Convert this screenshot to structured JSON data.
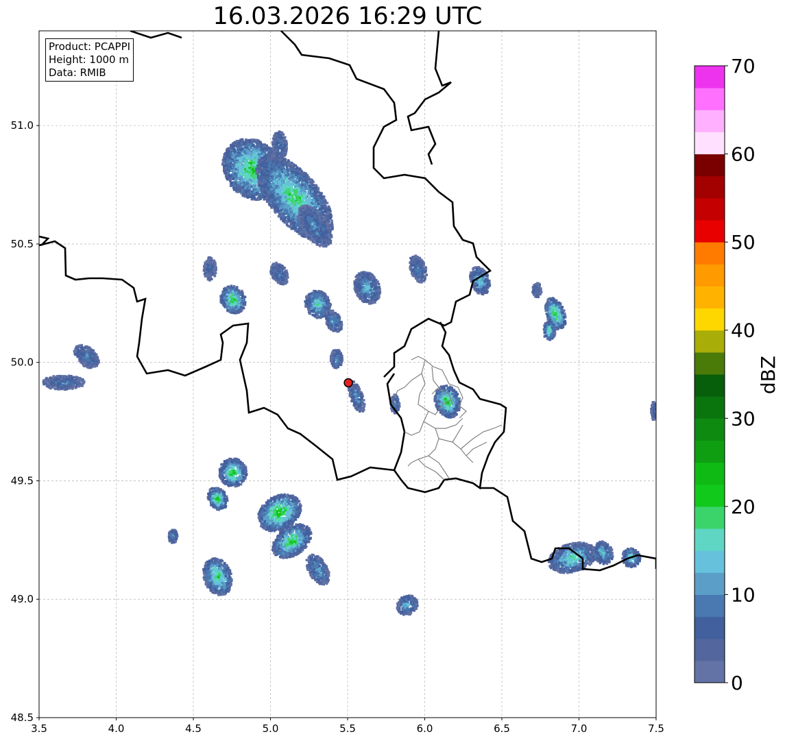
{
  "title": "16.03.2026 16:29 UTC",
  "info": {
    "product": "Product: PCAPPI",
    "height": "Height: 1000 m",
    "data": "Data: RMIB"
  },
  "axes": {
    "x_ticks": [
      "3.5",
      "4.0",
      "4.5",
      "5.0",
      "5.5",
      "6.0",
      "6.5",
      "7.0",
      "7.5"
    ],
    "y_ticks": [
      "51.0",
      "50.5",
      "50.0",
      "49.5",
      "49.0",
      "48.5"
    ],
    "xlim": [
      3.5,
      7.5
    ],
    "ylim": [
      48.5,
      51.4
    ],
    "grid": true
  },
  "colorbar": {
    "label": "dBZ",
    "ticks": [
      "0",
      "10",
      "20",
      "30",
      "40",
      "50",
      "60",
      "70"
    ],
    "range": [
      0,
      70
    ],
    "colors": [
      "#6373a6",
      "#53679e",
      "#42609e",
      "#4a78b0",
      "#5b9ec8",
      "#66c1dc",
      "#5fd6c3",
      "#3bd46b",
      "#11c91a",
      "#10ba14",
      "#0f9e12",
      "#0e8a10",
      "#0b750d",
      "#075e0b",
      "#4a7a08",
      "#a8ad08",
      "#ffd700",
      "#ffb300",
      "#ff9a00",
      "#ff7b00",
      "#e80000",
      "#c40000",
      "#a30000",
      "#7a0000",
      "#ffe1ff",
      "#ffb0ff",
      "#ff70ff",
      "#ee33ee"
    ]
  },
  "radar_site": {
    "lon": 5.505,
    "lat": 49.914,
    "color": "#e32222"
  },
  "echoes": [
    {
      "lon": 4.88,
      "lat": 50.82,
      "w": 0.18,
      "h": 0.14,
      "rot": -45,
      "intensity": 22
    },
    {
      "lon": 5.15,
      "lat": 50.7,
      "w": 0.16,
      "h": 0.22,
      "rot": -40,
      "intensity": 20
    },
    {
      "lon": 5.28,
      "lat": 50.58,
      "w": 0.08,
      "h": 0.1,
      "rot": -35,
      "intensity": 12
    },
    {
      "lon": 5.05,
      "lat": 50.92,
      "w": 0.05,
      "h": 0.06,
      "rot": 0,
      "intensity": 10
    },
    {
      "lon": 4.6,
      "lat": 50.4,
      "w": 0.04,
      "h": 0.05,
      "rot": 0,
      "intensity": 8
    },
    {
      "lon": 4.75,
      "lat": 50.27,
      "w": 0.08,
      "h": 0.06,
      "rot": -30,
      "intensity": 22
    },
    {
      "lon": 5.05,
      "lat": 50.38,
      "w": 0.05,
      "h": 0.05,
      "rot": -30,
      "intensity": 10
    },
    {
      "lon": 5.3,
      "lat": 50.25,
      "w": 0.08,
      "h": 0.06,
      "rot": -30,
      "intensity": 18
    },
    {
      "lon": 5.4,
      "lat": 50.18,
      "w": 0.05,
      "h": 0.05,
      "rot": -30,
      "intensity": 12
    },
    {
      "lon": 5.62,
      "lat": 50.32,
      "w": 0.08,
      "h": 0.07,
      "rot": -25,
      "intensity": 14
    },
    {
      "lon": 5.95,
      "lat": 50.4,
      "w": 0.05,
      "h": 0.06,
      "rot": -20,
      "intensity": 10
    },
    {
      "lon": 6.35,
      "lat": 50.35,
      "w": 0.06,
      "h": 0.06,
      "rot": -20,
      "intensity": 16
    },
    {
      "lon": 6.72,
      "lat": 50.31,
      "w": 0.03,
      "h": 0.03,
      "rot": 0,
      "intensity": 8
    },
    {
      "lon": 6.84,
      "lat": 50.21,
      "w": 0.06,
      "h": 0.07,
      "rot": -20,
      "intensity": 24
    },
    {
      "lon": 6.8,
      "lat": 50.14,
      "w": 0.04,
      "h": 0.04,
      "rot": 0,
      "intensity": 18
    },
    {
      "lon": 5.42,
      "lat": 50.02,
      "w": 0.04,
      "h": 0.04,
      "rot": 0,
      "intensity": 12
    },
    {
      "lon": 5.55,
      "lat": 49.86,
      "w": 0.04,
      "h": 0.07,
      "rot": -20,
      "intensity": 12
    },
    {
      "lon": 5.8,
      "lat": 49.83,
      "w": 0.03,
      "h": 0.04,
      "rot": 0,
      "intensity": 10
    },
    {
      "lon": 6.14,
      "lat": 49.84,
      "w": 0.08,
      "h": 0.07,
      "rot": -20,
      "intensity": 22
    },
    {
      "lon": 3.65,
      "lat": 49.92,
      "w": 0.14,
      "h": 0.03,
      "rot": 0,
      "intensity": 10
    },
    {
      "lon": 3.8,
      "lat": 50.03,
      "w": 0.06,
      "h": 0.06,
      "rot": -50,
      "intensity": 10
    },
    {
      "lon": 7.48,
      "lat": 49.8,
      "w": 0.02,
      "h": 0.04,
      "rot": 0,
      "intensity": 8
    },
    {
      "lon": 4.75,
      "lat": 49.54,
      "w": 0.09,
      "h": 0.06,
      "rot": -30,
      "intensity": 22
    },
    {
      "lon": 4.65,
      "lat": 49.43,
      "w": 0.06,
      "h": 0.05,
      "rot": -30,
      "intensity": 22
    },
    {
      "lon": 5.05,
      "lat": 49.37,
      "w": 0.15,
      "h": 0.07,
      "rot": -30,
      "intensity": 24
    },
    {
      "lon": 5.13,
      "lat": 49.25,
      "w": 0.14,
      "h": 0.06,
      "rot": -35,
      "intensity": 22
    },
    {
      "lon": 5.3,
      "lat": 49.13,
      "w": 0.06,
      "h": 0.07,
      "rot": -30,
      "intensity": 14
    },
    {
      "lon": 4.36,
      "lat": 49.27,
      "w": 0.03,
      "h": 0.03,
      "rot": 0,
      "intensity": 12
    },
    {
      "lon": 4.65,
      "lat": 49.1,
      "w": 0.09,
      "h": 0.08,
      "rot": -20,
      "intensity": 20
    },
    {
      "lon": 5.88,
      "lat": 48.98,
      "w": 0.07,
      "h": 0.04,
      "rot": -30,
      "intensity": 14
    },
    {
      "lon": 6.95,
      "lat": 49.18,
      "w": 0.16,
      "h": 0.06,
      "rot": -15,
      "intensity": 18
    },
    {
      "lon": 7.15,
      "lat": 49.2,
      "w": 0.06,
      "h": 0.05,
      "rot": -20,
      "intensity": 16
    },
    {
      "lon": 7.33,
      "lat": 49.18,
      "w": 0.06,
      "h": 0.04,
      "rot": -20,
      "intensity": 18
    }
  ]
}
